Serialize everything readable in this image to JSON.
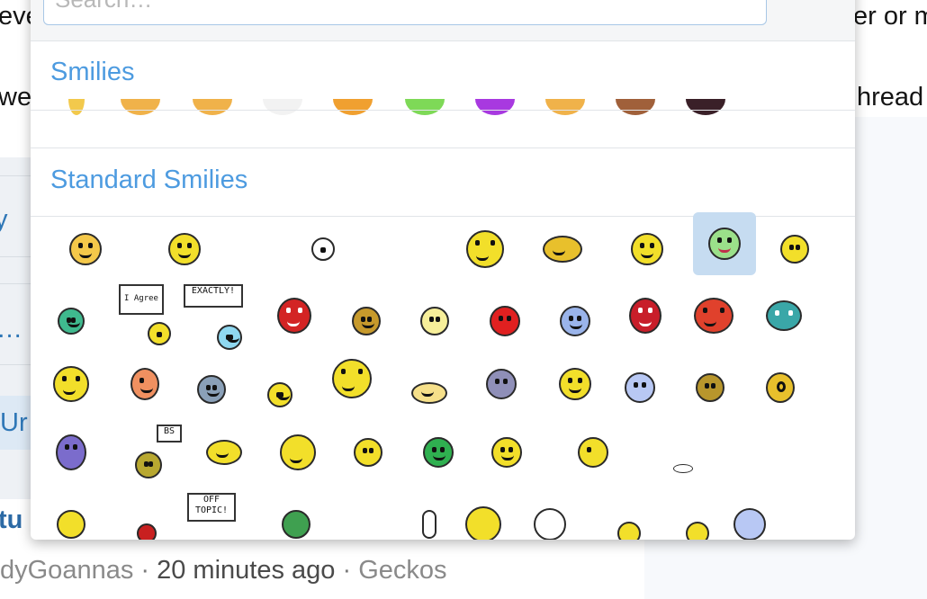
{
  "background": {
    "line1_left": "eve",
    "line1_right": "er or m",
    "line2_left": "we",
    "line2_right": "hread",
    "sidebar_frag1": "y",
    "sidebar_frag2": "…",
    "sidebar_frag3": "Ur",
    "heading_frag": "tu",
    "meta": {
      "author": "dyGoannas",
      "sep1": " · ",
      "time": "20 minutes ago",
      "sep2": " · ",
      "forum": "Geckos"
    }
  },
  "popup": {
    "search_placeholder": "Search…",
    "close_icon": "close-icon",
    "sections": [
      {
        "title": "Smilies"
      },
      {
        "title": "Standard Smilies"
      }
    ],
    "signs": {
      "agree": "I Agree",
      "exactly": "EXACTLY!",
      "bs": "BS",
      "off_topic": "OFF TOPIC!"
    }
  },
  "colors": {
    "accent": "#4d9be0",
    "selected": "#c6dcf1",
    "smiley_yellow": "#f2df2a"
  }
}
